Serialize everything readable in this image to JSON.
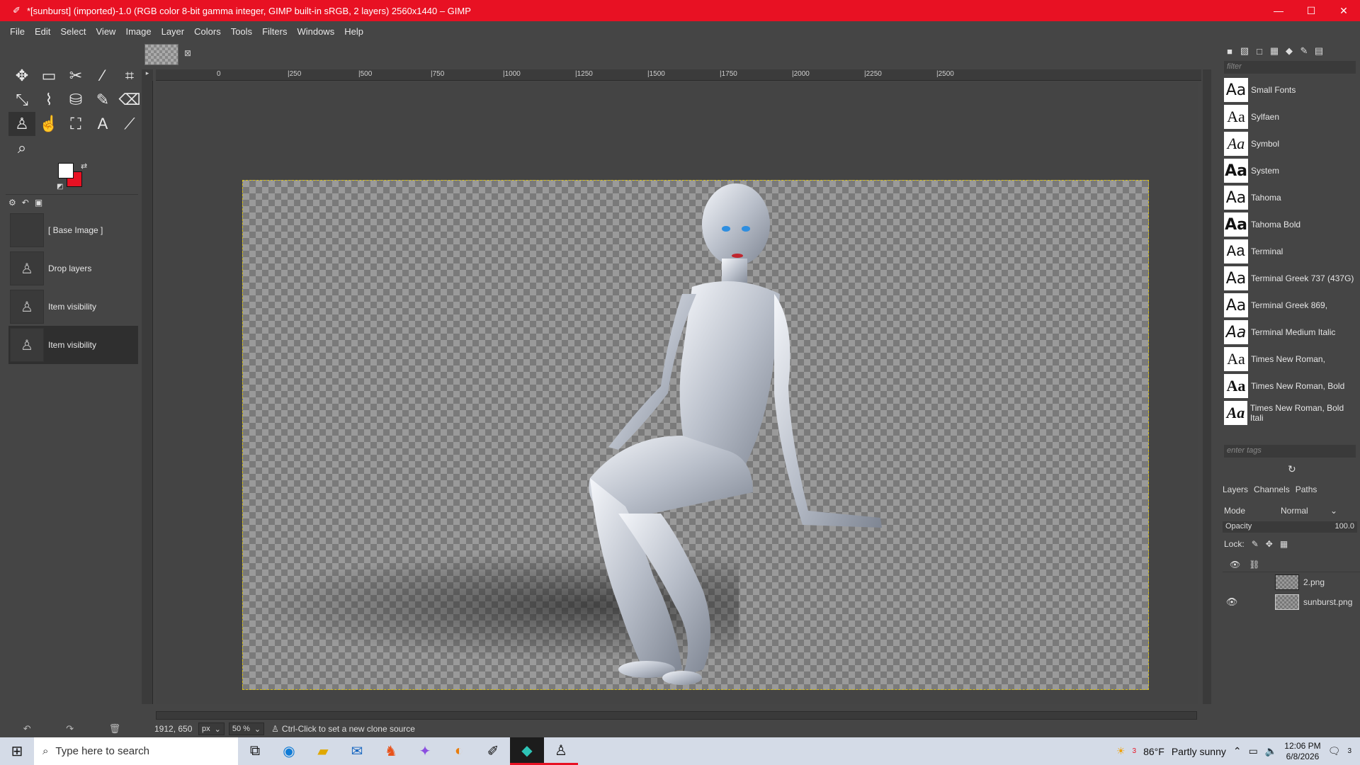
{
  "window": {
    "title": "*[sunburst] (imported)-1.0 (RGB color 8-bit gamma integer, GIMP built-in sRGB, 2 layers) 2560x1440 – GIMP",
    "minimize": "—",
    "maximize": "☐",
    "close": "✕"
  },
  "menu": [
    "File",
    "Edit",
    "Select",
    "View",
    "Image",
    "Layer",
    "Colors",
    "Tools",
    "Filters",
    "Windows",
    "Help"
  ],
  "tools": [
    {
      "name": "move-tool-icon",
      "glyph": "✥"
    },
    {
      "name": "rect-select-icon",
      "glyph": "▭"
    },
    {
      "name": "scissors-icon",
      "glyph": "✂"
    },
    {
      "name": "fuzzy-select-icon",
      "glyph": "⁄"
    },
    {
      "name": "crop-icon",
      "glyph": "⌗"
    },
    {
      "name": "unified-transform-icon",
      "glyph": "⤡"
    },
    {
      "name": "warp-icon",
      "glyph": "⌇"
    },
    {
      "name": "bucket-fill-icon",
      "glyph": "⛁"
    },
    {
      "name": "paintbrush-icon",
      "glyph": "✎"
    },
    {
      "name": "eraser-icon",
      "glyph": "⌫"
    },
    {
      "name": "clone-icon",
      "glyph": "♙"
    },
    {
      "name": "smudge-icon",
      "glyph": "☝"
    },
    {
      "name": "paths-icon",
      "glyph": "⛶"
    },
    {
      "name": "text-tool-icon",
      "glyph": "A"
    },
    {
      "name": "color-picker-icon",
      "glyph": "⟋"
    },
    {
      "name": "zoom-icon",
      "glyph": "⌕"
    }
  ],
  "undo_history": [
    {
      "label": "[ Base Image ]",
      "thumb": ""
    },
    {
      "label": "Drop layers",
      "thumb": "♙"
    },
    {
      "label": "Item visibility",
      "thumb": "♙"
    },
    {
      "label": "Item visibility",
      "thumb": "♙"
    }
  ],
  "ruler_labels": [
    "0",
    "|250",
    "|500",
    "|750",
    "|1000",
    "|1250",
    "|1500",
    "|1750",
    "|2000",
    "|2250",
    "|2500"
  ],
  "status": {
    "coords": "1912, 650",
    "unit": "px",
    "zoom": "50 %",
    "message": "Ctrl-Click to set a new clone source"
  },
  "fonts_panel": {
    "filter_placeholder": "filter",
    "tags_placeholder": "enter tags",
    "fonts": [
      {
        "name": "Small Fonts",
        "style": ""
      },
      {
        "name": "Sylfaen",
        "style": "serif"
      },
      {
        "name": "Symbol",
        "style": "serif italic"
      },
      {
        "name": "System",
        "style": "bold"
      },
      {
        "name": "Tahoma",
        "style": ""
      },
      {
        "name": "Tahoma Bold",
        "style": "bold"
      },
      {
        "name": "Terminal",
        "style": "mono"
      },
      {
        "name": "Terminal Greek 737 (437G)",
        "style": ""
      },
      {
        "name": "Terminal Greek 869,",
        "style": ""
      },
      {
        "name": "Terminal Medium Italic",
        "style": "italic"
      },
      {
        "name": "Times New Roman,",
        "style": "serif"
      },
      {
        "name": "Times New Roman, Bold",
        "style": "serif bold"
      },
      {
        "name": "Times New Roman, Bold Itali",
        "style": "serif bold italic"
      }
    ],
    "sample": "Aa"
  },
  "layers_panel": {
    "tabs": [
      "Layers",
      "Channels",
      "Paths"
    ],
    "mode_label": "Mode",
    "mode_value": "Normal",
    "opacity_label": "Opacity",
    "opacity_value": "100.0",
    "lock_label": "Lock:",
    "layers": [
      {
        "name": "2.png",
        "visible": false
      },
      {
        "name": "sunburst.png",
        "visible": true
      }
    ]
  },
  "taskbar": {
    "search_placeholder": "Type here to search",
    "weather_badge": "3",
    "weather_temp": "86°F",
    "weather_text": "Partly sunny",
    "time": "12:06 PM",
    "date": "6/8/2026",
    "notification_count": "3"
  },
  "colors": {
    "accent": "#e81123",
    "foreground": "#ffffff",
    "background": "#e81123",
    "selection_border": "#d8c21a"
  }
}
